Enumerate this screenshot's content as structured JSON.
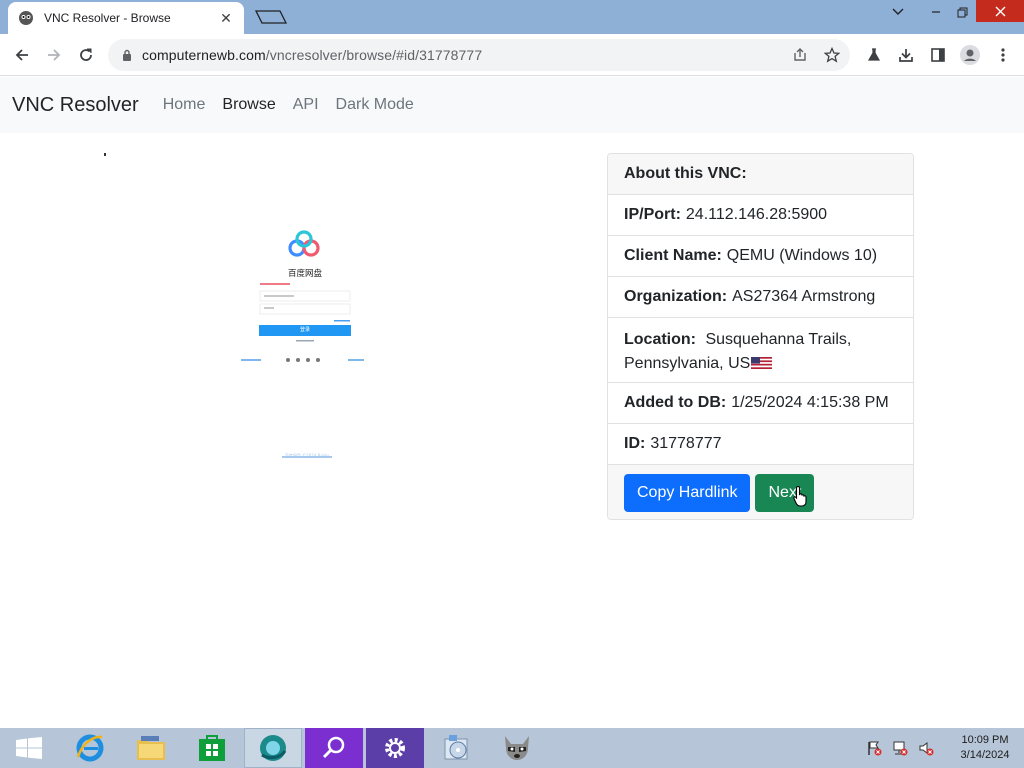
{
  "browser": {
    "tab_title": "VNC Resolver - Browse",
    "url_domain": "computernewb.com",
    "url_path": "/vncresolver/browse/#id/31778777"
  },
  "nav": {
    "brand": "VNC Resolver",
    "links": [
      "Home",
      "Browse",
      "API",
      "Dark Mode"
    ]
  },
  "preview": {
    "app_name": "百度网盘",
    "login_button": "登录",
    "footer_text": "百度网盘 ©2024 Baidu"
  },
  "card": {
    "header": "About this VNC:",
    "ip_label": "IP/Port:",
    "ip_value": "24.112.146.28:5900",
    "client_label": "Client Name:",
    "client_value": "QEMU (Windows 10)",
    "org_label": "Organization:",
    "org_value": "AS27364 Armstrong",
    "location_label": "Location:",
    "location_value_line1": "Susquehanna Trails,",
    "location_value_line2": "Pennsylvania, US",
    "added_label": "Added to DB:",
    "added_value": "1/25/2024 4:15:38 PM",
    "id_label": "ID:",
    "id_value": "31778777",
    "copy_button": "Copy Hardlink",
    "next_button": "Next"
  },
  "taskbar": {
    "time": "10:09 PM",
    "date": "3/14/2024"
  },
  "colors": {
    "primary": "#0d6efd",
    "success": "#198754",
    "tabstrip": "#8eafd6",
    "taskbar": "#b6c6d8"
  }
}
